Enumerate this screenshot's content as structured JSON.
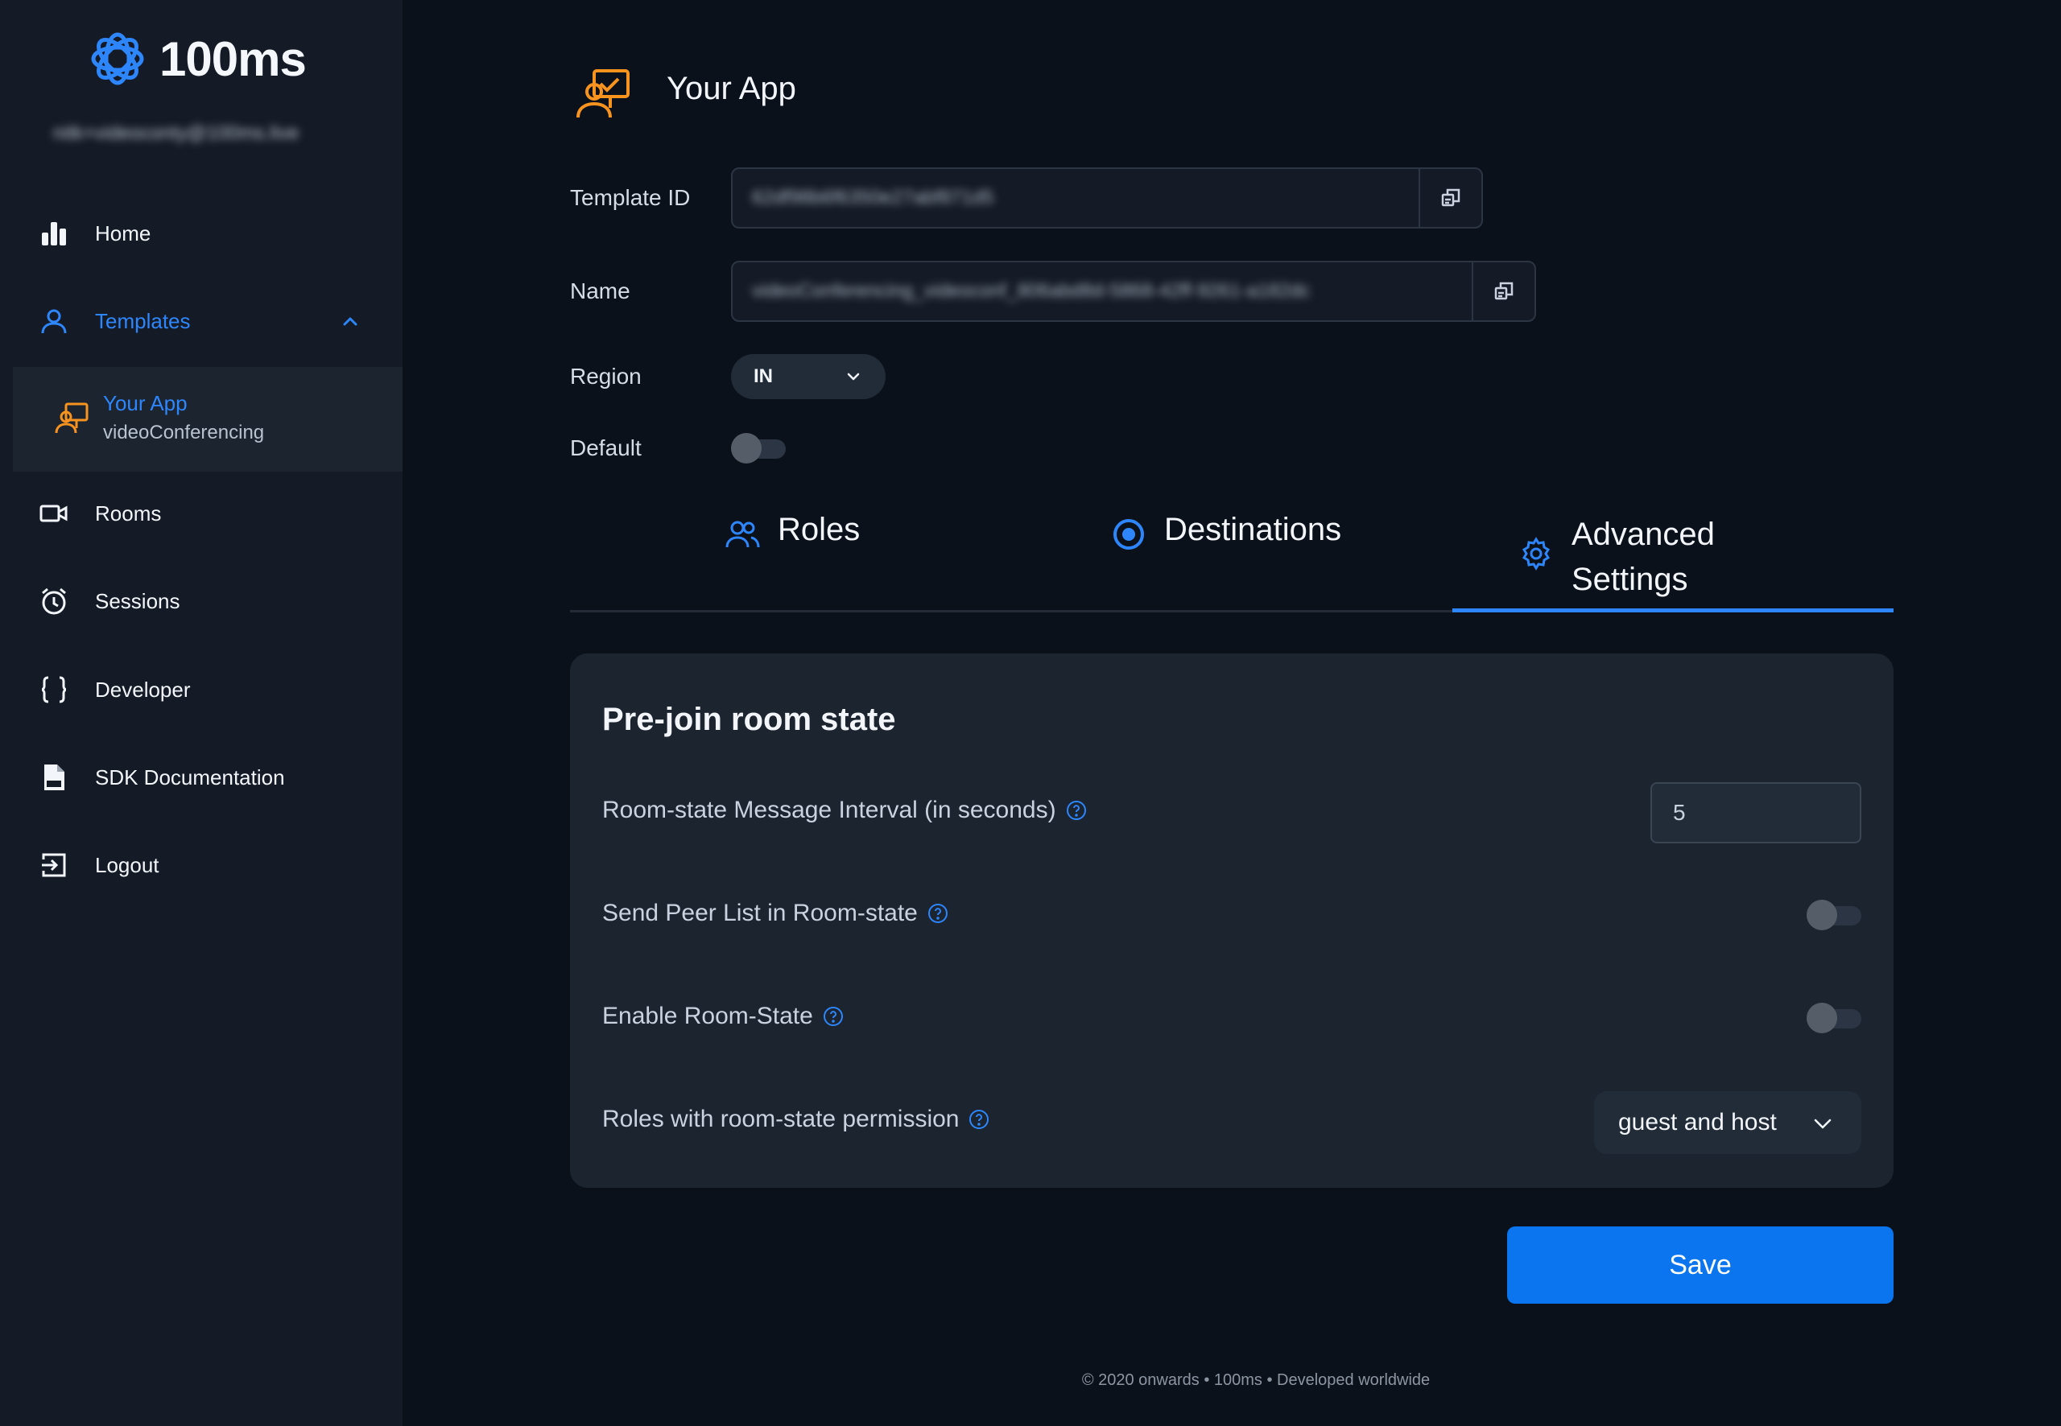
{
  "brand": {
    "name": "100ms",
    "user_email": "nitk+videoconty@100ms.live"
  },
  "sidebar": {
    "items": [
      {
        "label": "Home",
        "icon": "bar-chart-icon"
      },
      {
        "label": "Templates",
        "icon": "user-icon",
        "expanded": true
      },
      {
        "label": "Rooms",
        "icon": "video-camera-icon"
      },
      {
        "label": "Sessions",
        "icon": "alarm-clock-icon"
      },
      {
        "label": "Developer",
        "icon": "curly-braces-icon"
      },
      {
        "label": "SDK Documentation",
        "icon": "doc-file-icon"
      },
      {
        "label": "Logout",
        "icon": "logout-icon"
      }
    ],
    "sub_item": {
      "title": "Your App",
      "subtitle": "videoConferencing"
    }
  },
  "main": {
    "title": "Your App",
    "fields": {
      "template_id": {
        "label": "Template ID",
        "value": "62df98b6f6350e27abf871d5"
      },
      "name": {
        "label": "Name",
        "value": "videoConferencing_videoconf_806abd8d-5868-42ff-9261-a182dc"
      },
      "region": {
        "label": "Region",
        "value": "IN"
      },
      "default": {
        "label": "Default",
        "on": false
      }
    },
    "tabs": [
      {
        "label": "Roles",
        "icon": "users-icon"
      },
      {
        "label": "Destinations",
        "icon": "radio-target-icon"
      },
      {
        "label": "Advanced Settings",
        "line1": "Advanced",
        "line2": "Settings",
        "icon": "gear-icon",
        "active": true
      }
    ],
    "card": {
      "title": "Pre-join room state",
      "interval": {
        "label": "Room-state Message Interval (in seconds)",
        "value": "5"
      },
      "send_peer_list": {
        "label": "Send Peer List in Room-state",
        "on": false
      },
      "enable_room_state": {
        "label": "Enable Room-State",
        "on": false
      },
      "roles": {
        "label": "Roles with room-state permission",
        "value": "guest and host"
      }
    },
    "save_label": "Save"
  },
  "footer": {
    "text": "© 2020 onwards • 100ms • Developed worldwide"
  },
  "colors": {
    "accent": "#2e86ff",
    "button": "#0b75f0",
    "app_icon": "#f7931e",
    "background": "#0b111a",
    "sidebar": "#141b26"
  }
}
